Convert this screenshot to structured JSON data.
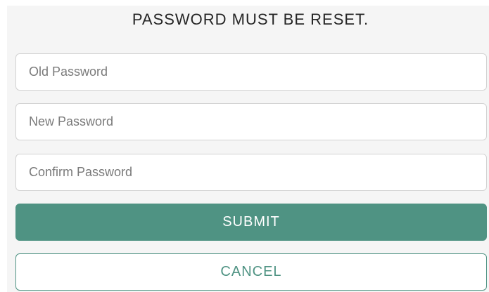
{
  "form": {
    "title": "PASSWORD MUST BE RESET.",
    "old_password": {
      "placeholder": "Old Password",
      "value": ""
    },
    "new_password": {
      "placeholder": "New Password",
      "value": ""
    },
    "confirm_password": {
      "placeholder": "Confirm Password",
      "value": ""
    },
    "submit_label": "SUBMIT",
    "cancel_label": "CANCEL"
  },
  "colors": {
    "accent": "#4f9383",
    "panel_background": "#f5f5f5",
    "field_border": "#d2d2d2"
  }
}
